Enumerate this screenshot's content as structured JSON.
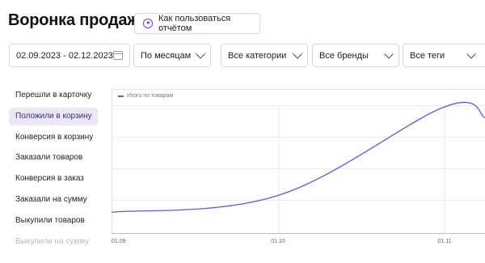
{
  "header": {
    "title": "Воронка продаж",
    "help_button_label": "Как пользоваться отчётом"
  },
  "filters": {
    "date_range": "02.09.2023 - 02.12.2023",
    "period": "По месяцам",
    "categories": "Все категории",
    "brands": "Все бренды",
    "tags": "Все теги"
  },
  "metrics": [
    {
      "label": "Перешли в карточку",
      "active": false
    },
    {
      "label": "Положили в корзину",
      "active": true
    },
    {
      "label": "Конверсия в корзину",
      "active": false
    },
    {
      "label": "Заказали товаров",
      "active": false
    },
    {
      "label": "Конверсия в заказ",
      "active": false
    },
    {
      "label": "Заказали на сумму",
      "active": false
    },
    {
      "label": "Выкупили товаров",
      "active": false
    },
    {
      "label": "Выкупили на сумму",
      "active": false
    }
  ],
  "chart_data": {
    "type": "line",
    "legend": [
      "Итого по товарам"
    ],
    "x_ticks": [
      "01.09",
      "01.10",
      "01.11"
    ],
    "series": [
      {
        "name": "Итого по товарам",
        "color": "#5a5fd6",
        "points": [
          {
            "x": "01.09",
            "y": 0.12
          },
          {
            "x": "01.10",
            "y": 0.26
          },
          {
            "x": "01.11",
            "y": 1.0
          },
          {
            "x": "02.12",
            "y": 0.91
          }
        ]
      }
    ],
    "grid": true,
    "legend_position": "top-left"
  },
  "colors": {
    "accent": "#6b3fd3",
    "line": "#5a5fd6",
    "active_bg": "#ebe7f7"
  }
}
